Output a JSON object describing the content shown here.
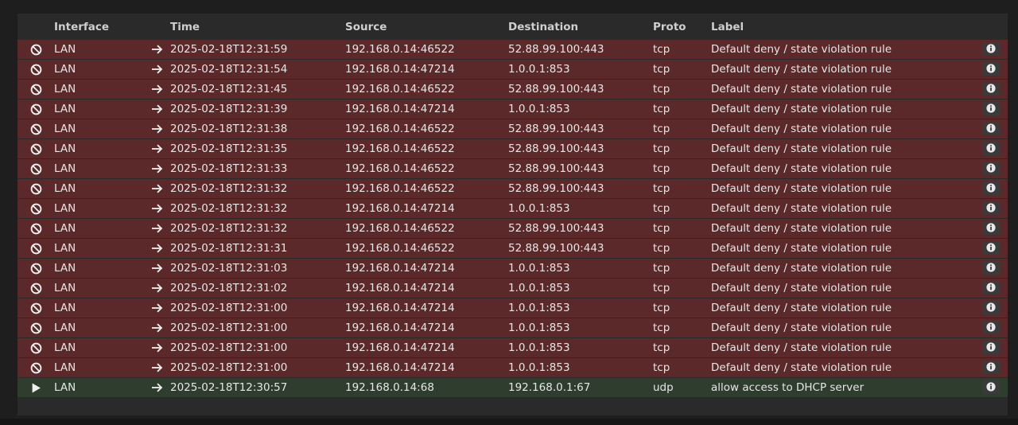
{
  "columns": {
    "action": "",
    "interface": "Interface",
    "direction": "",
    "time": "Time",
    "source": "Source",
    "destination": "Destination",
    "proto": "Proto",
    "label": "Label"
  },
  "colors": {
    "block_row": "#5c292a",
    "pass_row": "#2f3d2f"
  },
  "rows": [
    {
      "action": "block",
      "action_icon": "block-icon",
      "interface": "LAN",
      "direction_icon": "arrow-right-icon",
      "time": "2025-02-18T12:31:59",
      "source": "192.168.0.14:46522",
      "destination": "52.88.99.100:443",
      "proto": "tcp",
      "label": "Default deny / state violation rule",
      "info_icon": "info-icon"
    },
    {
      "action": "block",
      "action_icon": "block-icon",
      "interface": "LAN",
      "direction_icon": "arrow-right-icon",
      "time": "2025-02-18T12:31:54",
      "source": "192.168.0.14:47214",
      "destination": "1.0.0.1:853",
      "proto": "tcp",
      "label": "Default deny / state violation rule",
      "info_icon": "info-icon"
    },
    {
      "action": "block",
      "action_icon": "block-icon",
      "interface": "LAN",
      "direction_icon": "arrow-right-icon",
      "time": "2025-02-18T12:31:45",
      "source": "192.168.0.14:46522",
      "destination": "52.88.99.100:443",
      "proto": "tcp",
      "label": "Default deny / state violation rule",
      "info_icon": "info-icon"
    },
    {
      "action": "block",
      "action_icon": "block-icon",
      "interface": "LAN",
      "direction_icon": "arrow-right-icon",
      "time": "2025-02-18T12:31:39",
      "source": "192.168.0.14:47214",
      "destination": "1.0.0.1:853",
      "proto": "tcp",
      "label": "Default deny / state violation rule",
      "info_icon": "info-icon"
    },
    {
      "action": "block",
      "action_icon": "block-icon",
      "interface": "LAN",
      "direction_icon": "arrow-right-icon",
      "time": "2025-02-18T12:31:38",
      "source": "192.168.0.14:46522",
      "destination": "52.88.99.100:443",
      "proto": "tcp",
      "label": "Default deny / state violation rule",
      "info_icon": "info-icon"
    },
    {
      "action": "block",
      "action_icon": "block-icon",
      "interface": "LAN",
      "direction_icon": "arrow-right-icon",
      "time": "2025-02-18T12:31:35",
      "source": "192.168.0.14:46522",
      "destination": "52.88.99.100:443",
      "proto": "tcp",
      "label": "Default deny / state violation rule",
      "info_icon": "info-icon"
    },
    {
      "action": "block",
      "action_icon": "block-icon",
      "interface": "LAN",
      "direction_icon": "arrow-right-icon",
      "time": "2025-02-18T12:31:33",
      "source": "192.168.0.14:46522",
      "destination": "52.88.99.100:443",
      "proto": "tcp",
      "label": "Default deny / state violation rule",
      "info_icon": "info-icon"
    },
    {
      "action": "block",
      "action_icon": "block-icon",
      "interface": "LAN",
      "direction_icon": "arrow-right-icon",
      "time": "2025-02-18T12:31:32",
      "source": "192.168.0.14:46522",
      "destination": "52.88.99.100:443",
      "proto": "tcp",
      "label": "Default deny / state violation rule",
      "info_icon": "info-icon"
    },
    {
      "action": "block",
      "action_icon": "block-icon",
      "interface": "LAN",
      "direction_icon": "arrow-right-icon",
      "time": "2025-02-18T12:31:32",
      "source": "192.168.0.14:47214",
      "destination": "1.0.0.1:853",
      "proto": "tcp",
      "label": "Default deny / state violation rule",
      "info_icon": "info-icon"
    },
    {
      "action": "block",
      "action_icon": "block-icon",
      "interface": "LAN",
      "direction_icon": "arrow-right-icon",
      "time": "2025-02-18T12:31:32",
      "source": "192.168.0.14:46522",
      "destination": "52.88.99.100:443",
      "proto": "tcp",
      "label": "Default deny / state violation rule",
      "info_icon": "info-icon"
    },
    {
      "action": "block",
      "action_icon": "block-icon",
      "interface": "LAN",
      "direction_icon": "arrow-right-icon",
      "time": "2025-02-18T12:31:31",
      "source": "192.168.0.14:46522",
      "destination": "52.88.99.100:443",
      "proto": "tcp",
      "label": "Default deny / state violation rule",
      "info_icon": "info-icon"
    },
    {
      "action": "block",
      "action_icon": "block-icon",
      "interface": "LAN",
      "direction_icon": "arrow-right-icon",
      "time": "2025-02-18T12:31:03",
      "source": "192.168.0.14:47214",
      "destination": "1.0.0.1:853",
      "proto": "tcp",
      "label": "Default deny / state violation rule",
      "info_icon": "info-icon"
    },
    {
      "action": "block",
      "action_icon": "block-icon",
      "interface": "LAN",
      "direction_icon": "arrow-right-icon",
      "time": "2025-02-18T12:31:02",
      "source": "192.168.0.14:47214",
      "destination": "1.0.0.1:853",
      "proto": "tcp",
      "label": "Default deny / state violation rule",
      "info_icon": "info-icon"
    },
    {
      "action": "block",
      "action_icon": "block-icon",
      "interface": "LAN",
      "direction_icon": "arrow-right-icon",
      "time": "2025-02-18T12:31:00",
      "source": "192.168.0.14:47214",
      "destination": "1.0.0.1:853",
      "proto": "tcp",
      "label": "Default deny / state violation rule",
      "info_icon": "info-icon"
    },
    {
      "action": "block",
      "action_icon": "block-icon",
      "interface": "LAN",
      "direction_icon": "arrow-right-icon",
      "time": "2025-02-18T12:31:00",
      "source": "192.168.0.14:47214",
      "destination": "1.0.0.1:853",
      "proto": "tcp",
      "label": "Default deny / state violation rule",
      "info_icon": "info-icon"
    },
    {
      "action": "block",
      "action_icon": "block-icon",
      "interface": "LAN",
      "direction_icon": "arrow-right-icon",
      "time": "2025-02-18T12:31:00",
      "source": "192.168.0.14:47214",
      "destination": "1.0.0.1:853",
      "proto": "tcp",
      "label": "Default deny / state violation rule",
      "info_icon": "info-icon"
    },
    {
      "action": "block",
      "action_icon": "block-icon",
      "interface": "LAN",
      "direction_icon": "arrow-right-icon",
      "time": "2025-02-18T12:31:00",
      "source": "192.168.0.14:47214",
      "destination": "1.0.0.1:853",
      "proto": "tcp",
      "label": "Default deny / state violation rule",
      "info_icon": "info-icon"
    },
    {
      "action": "pass",
      "action_icon": "play-icon",
      "interface": "LAN",
      "direction_icon": "arrow-right-icon",
      "time": "2025-02-18T12:30:57",
      "source": "192.168.0.14:68",
      "destination": "192.168.0.1:67",
      "proto": "udp",
      "label": "allow access to DHCP server",
      "info_icon": "info-icon"
    }
  ]
}
